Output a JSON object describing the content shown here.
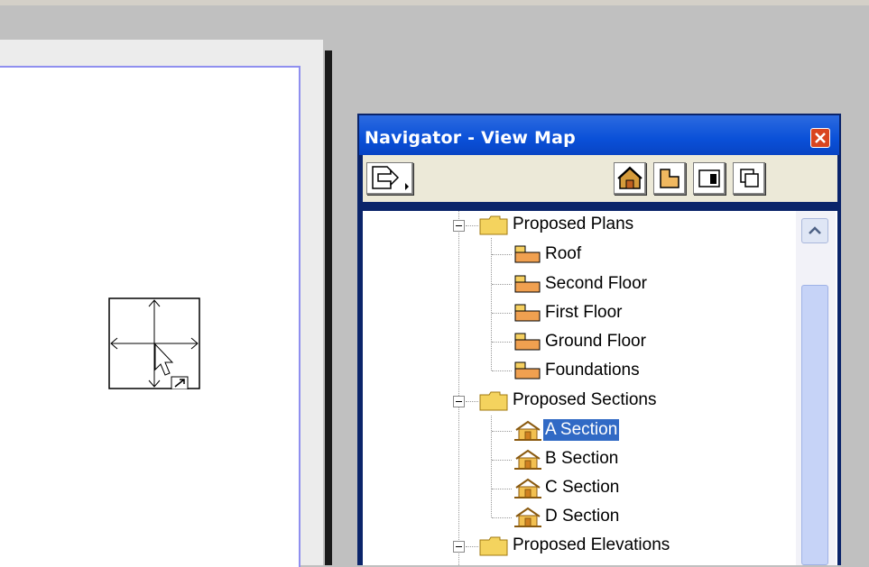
{
  "navigator": {
    "title": "Navigator - View Map",
    "toolbar": {
      "publish_icon": "document-arrow-icon",
      "views": [
        "3d-house-icon",
        "floor-plan-icon",
        "elevation-icon",
        "clone-icon"
      ]
    },
    "tree": {
      "groups": [
        {
          "label": "Proposed Plans",
          "expanded": true,
          "items": [
            "Roof",
            "Second Floor",
            "First Floor",
            "Ground Floor",
            "Foundations"
          ],
          "item_icon": "floor-plan-icon"
        },
        {
          "label": "Proposed Sections",
          "expanded": true,
          "items": [
            "A Section",
            "B Section",
            "C Section",
            "D Section"
          ],
          "item_icon": "section-icon",
          "selected": "A Section"
        },
        {
          "label": "Proposed Elevations",
          "expanded": true,
          "items": []
        }
      ]
    }
  },
  "colors": {
    "titlebar": "#0a50d8",
    "selection": "#316ac5",
    "sheet_border": "#8f8fef"
  }
}
